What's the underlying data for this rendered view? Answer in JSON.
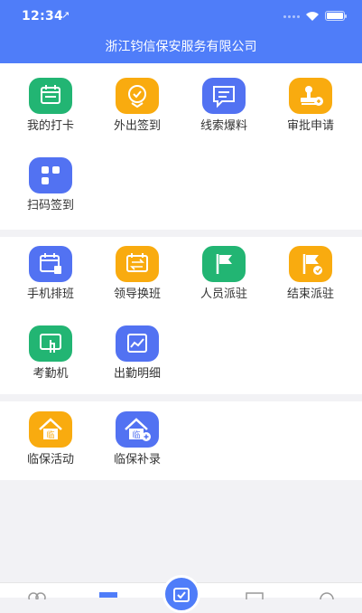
{
  "status_bar": {
    "time": "12:34",
    "location_glyph": "↗"
  },
  "header": {
    "title": "浙江钧信保安服务有限公司"
  },
  "section1": [
    {
      "label": "我的打卡",
      "icon": "calendar-icon",
      "color": "#22b573"
    },
    {
      "label": "外出签到",
      "icon": "check-location-icon",
      "color": "#f9ab0f"
    },
    {
      "label": "线索爆料",
      "icon": "message-icon",
      "color": "#5272f2"
    },
    {
      "label": "审批申请",
      "icon": "stamp-icon",
      "color": "#f9ab0f"
    },
    {
      "label": "扫码签到",
      "icon": "qrcode-icon",
      "color": "#5272f2"
    }
  ],
  "section2": [
    {
      "label": "手机排班",
      "icon": "schedule-icon",
      "color": "#5272f2"
    },
    {
      "label": "领导换班",
      "icon": "swap-icon",
      "color": "#f9ab0f"
    },
    {
      "label": "人员派驻",
      "icon": "flag-icon",
      "color": "#22b573"
    },
    {
      "label": "结束派驻",
      "icon": "flag-check-icon",
      "color": "#f9ab0f"
    },
    {
      "label": "考勤机",
      "icon": "touch-icon",
      "color": "#22b573"
    },
    {
      "label": "出勤明细",
      "icon": "chart-icon",
      "color": "#5272f2"
    }
  ],
  "section3": [
    {
      "label": "临保活动",
      "icon": "house-icon",
      "color": "#f9ab0f",
      "glyph": "临"
    },
    {
      "label": "临保补录",
      "icon": "house-add-icon",
      "color": "#5272f2",
      "glyph": "临"
    }
  ],
  "colors": {
    "accent": "#4f7df9",
    "green": "#22b573",
    "orange": "#f9ab0f",
    "blue": "#5272f2"
  }
}
